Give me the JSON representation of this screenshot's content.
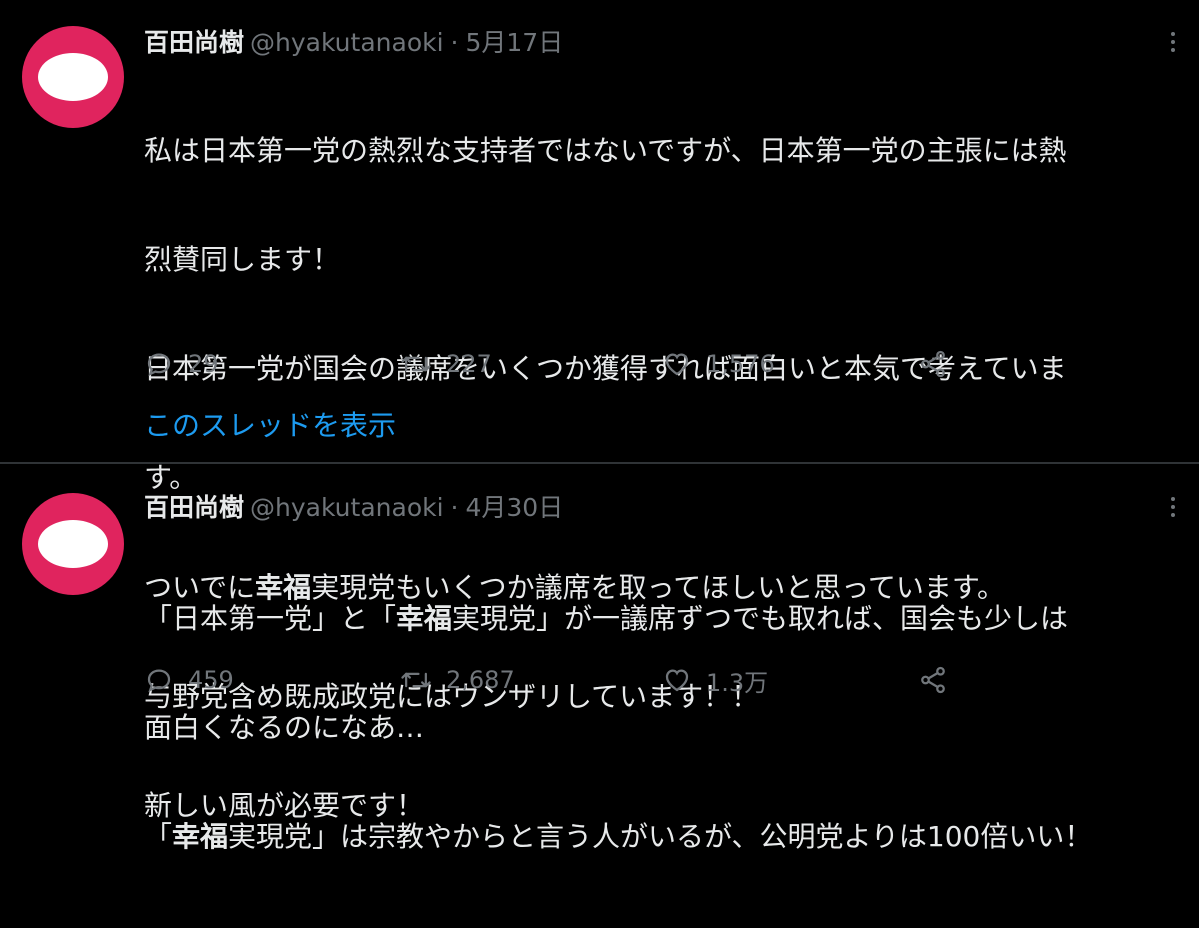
{
  "tweets": [
    {
      "author_name": "百田尚樹",
      "handle": "@hyakutanaoki",
      "separator": "·",
      "date": "5月17日",
      "avatar_icon": "avatar-icon",
      "lines": [
        "私は日本第一党の熱烈な支持者ではないですが、日本第一党の主張には熱",
        "烈賛同します！",
        "日本第一党が国会の議席をいくつか獲得すれば面白いと本気で考えていま",
        "す。",
        [
          "ついでに",
          "幸福",
          "実現党もいくつか議席を取ってほしいと思っています。"
        ],
        "与野党含め既成政党にはウンザリしています！！",
        "新しい風が必要です！"
      ],
      "replies": "29",
      "retweets": "227",
      "likes": "1,576",
      "thread_link": "このスレッドを表示"
    },
    {
      "author_name": "百田尚樹",
      "handle": "@hyakutanaoki",
      "separator": "·",
      "date": "4月30日",
      "avatar_icon": "avatar-icon",
      "lines": [
        [
          "「日本第一党」と「",
          "幸福",
          "実現党」が一議席ずつでも取れば、国会も少しは"
        ],
        "面白くなるのになあ…",
        [
          "「",
          "幸福",
          "実現党」は宗教やからと言う人がいるが、公明党よりは100倍いい！"
        ]
      ],
      "replies": "459",
      "retweets": "2,687",
      "likes": "1.3万"
    }
  ],
  "colors": {
    "background": "#000000",
    "text": "#e7e9ea",
    "secondary": "#71767b",
    "link": "#1d9bf0",
    "avatar": "#e0245e"
  }
}
